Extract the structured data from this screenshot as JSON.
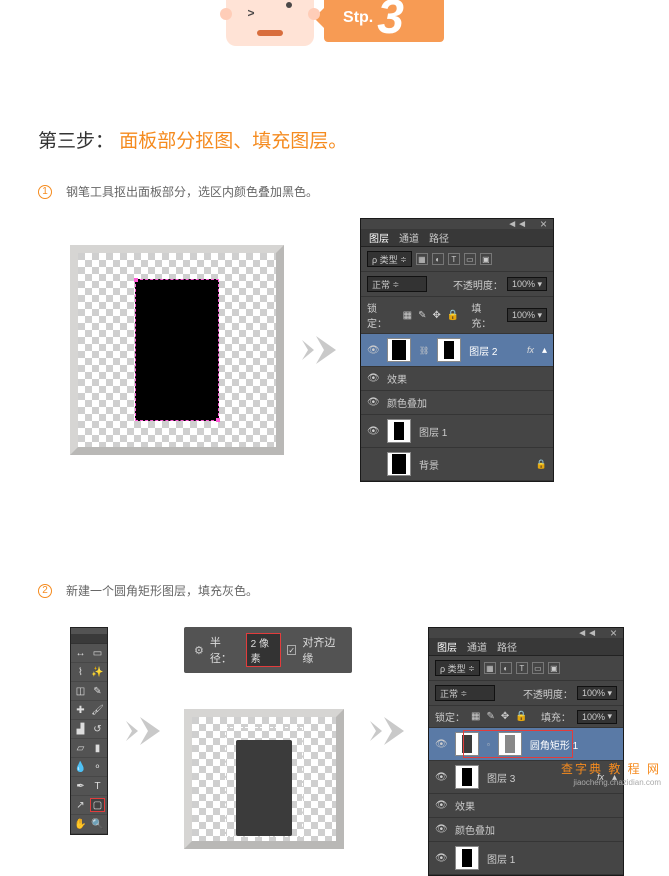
{
  "banner": {
    "stp": "Stp.",
    "num": "3"
  },
  "title": {
    "prefix": "第三步：",
    "highlight": "面板部分抠图、填充图层。"
  },
  "step1": {
    "num": "1",
    "text": "钢笔工具抠出面板部分，选区内颜色叠加黑色。"
  },
  "step2": {
    "num": "2",
    "text": "新建一个圆角矩形图层，填充灰色。",
    "radius_label": "半径：",
    "radius_val": "2 像素",
    "align_label": "对齐边缘"
  },
  "ps": {
    "tabs": {
      "layers": "图层",
      "channels": "通道",
      "paths": "路径"
    },
    "kind": "ρ 类型",
    "blend": "正常",
    "opacity_label": "不透明度：",
    "opacity_val": "100%",
    "lock_label": "锁定：",
    "fill_label": "填充：",
    "fill_val": "100%",
    "icons": {
      "img": "▦",
      "fx": "fx",
      "mask": "◐",
      "txt": "T",
      "shape": "▭",
      "smart": "▣"
    }
  },
  "layersA": {
    "l2": "图层 2",
    "fx_lbl": "效果",
    "overlay": "颜色叠加",
    "l1": "图层 1",
    "bg": "背景"
  },
  "layersB": {
    "rr": "圆角矩形 1",
    "l3": "图层 3",
    "l1": "图层 1",
    "overlay": "颜色叠加",
    "fx_lbl": "效果"
  },
  "watermark": {
    "brand": "查字典  教 程 网",
    "url": "jiaocheng.chazidian.com"
  }
}
